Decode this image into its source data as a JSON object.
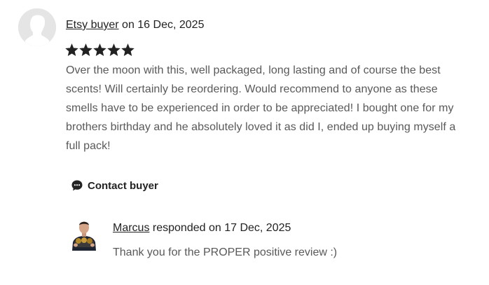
{
  "review": {
    "author": "Etsy buyer",
    "date_prefix": " on ",
    "date": "16 Dec, 2025",
    "rating": 5,
    "rating_max": 5,
    "text": "Over the moon with this, well packaged, long lasting and of course the best scents! Will certainly be reordering. Would recommend to anyone as these smells have to be experienced in order to be appreciated! I bought one for my brothers birthday and he absolutely loved it as did I, ended up buying myself a full pack!",
    "contact_label": "Contact buyer"
  },
  "response": {
    "author": "Marcus",
    "date_prefix": " responded on ",
    "date": "17 Dec, 2025",
    "text": "Thank you for the PROPER positive review :)"
  },
  "colors": {
    "text_primary": "#222222",
    "text_secondary": "#595959",
    "avatar_bg": "#e5e5e5",
    "star": "#222222"
  },
  "icons": {
    "buyer_avatar": "default-person-avatar",
    "star": "star-icon",
    "contact": "chat-bubble-icon",
    "seller_avatar": "seller-photo"
  }
}
